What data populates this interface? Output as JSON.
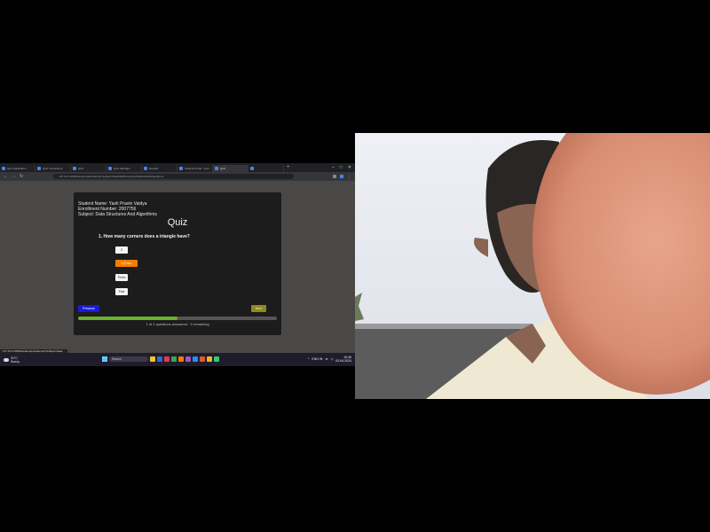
{
  "browser": {
    "tabs": [
      {
        "label": "Quiz Application",
        "active": false
      },
      {
        "label": "Quiz Instructions",
        "active": false
      },
      {
        "label": "Quiz",
        "active": false
      },
      {
        "label": "Quiz Manager",
        "active": false
      },
      {
        "label": "Results",
        "active": false
      },
      {
        "label": "Student Portal - Quiz",
        "active": false
      },
      {
        "label": "Quiz",
        "active": true
      },
      {
        "label": "",
        "active": false
      }
    ],
    "url": "127.0.0.1:5000/student/quiz/attempt?subject=Data%20Structures%20and%20Algorithms"
  },
  "quiz": {
    "student_name": "Student Name: Yash Pravin Vaidya",
    "enrollment": "Enrollment Number: 2007756",
    "subject": "Subject: Data Structures And Algorithms",
    "title": "Quiz",
    "question": "1. How many corners does a triangle have?",
    "options": [
      "2",
      "3 (Four)",
      "Three",
      "Five"
    ],
    "selected_index": 1,
    "previous_label": "Previous",
    "next_label": "Next",
    "progress": 0.5,
    "progress_text": "1 of 1 questions answered · 0 remaining"
  },
  "statusbar": {
    "text": "127.0.0.1:5000/student/quiz/attempt?subject=Data..."
  },
  "taskbar": {
    "weather_temp": "31°C",
    "weather_desc": "Sunny",
    "search_placeholder": "Search",
    "lang": "ENG IN",
    "time": "10:46",
    "date": "03-04-2024",
    "app_colors": [
      "#f4c430",
      "#2b6cdb",
      "#e63946",
      "#34a853",
      "#ff7a00",
      "#9b59b6",
      "#1e90ff",
      "#e4572e",
      "#f0b429",
      "#2ecc71"
    ]
  },
  "colors": {
    "selected_option": "#f57c00",
    "previous_button": "#1a1adb",
    "next_button": "#8f8a1f",
    "progress": "#6ab22a"
  }
}
